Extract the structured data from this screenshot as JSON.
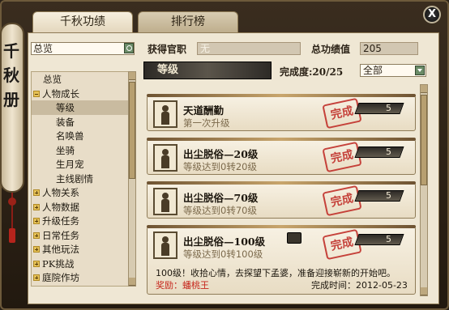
{
  "sidebar": {
    "title": "千秋册"
  },
  "tabs": [
    {
      "label": "千秋功绩",
      "active": true
    },
    {
      "label": "排行榜",
      "active": false
    }
  ],
  "close_label": "X",
  "search": {
    "value": "总览"
  },
  "tree": [
    {
      "label": "总览",
      "indent": 1,
      "toggle": "none"
    },
    {
      "label": "人物成长",
      "indent": 0,
      "toggle": "minus"
    },
    {
      "label": "等级",
      "indent": 2,
      "toggle": "none",
      "selected": true
    },
    {
      "label": "装备",
      "indent": 2,
      "toggle": "none"
    },
    {
      "label": "名唤兽",
      "indent": 2,
      "toggle": "none"
    },
    {
      "label": "坐骑",
      "indent": 2,
      "toggle": "none"
    },
    {
      "label": "生月宠",
      "indent": 2,
      "toggle": "none"
    },
    {
      "label": "主线剧情",
      "indent": 2,
      "toggle": "none"
    },
    {
      "label": "人物关系",
      "indent": 0,
      "toggle": "plus"
    },
    {
      "label": "人物数据",
      "indent": 0,
      "toggle": "plus"
    },
    {
      "label": "升级任务",
      "indent": 0,
      "toggle": "plus"
    },
    {
      "label": "日常任务",
      "indent": 0,
      "toggle": "plus"
    },
    {
      "label": "其他玩法",
      "indent": 0,
      "toggle": "plus"
    },
    {
      "label": "PK挑战",
      "indent": 0,
      "toggle": "plus"
    },
    {
      "label": "庭院作坊",
      "indent": 0,
      "toggle": "plus"
    }
  ],
  "header": {
    "title_label": "获得官职",
    "title_value": "无",
    "total_label": "总功绩值",
    "total_value": "205",
    "section": "等级",
    "progress_label": "完成度:20/25",
    "filter_value": "全部"
  },
  "achievements": [
    {
      "title": "天道酬勤",
      "desc": "第一次升级",
      "points": "5",
      "stamp": "完成"
    },
    {
      "title": "出尘脱俗—20级",
      "desc": "等级达到0转20级",
      "points": "5",
      "stamp": "完成"
    },
    {
      "title": "出尘脱俗—70级",
      "desc": "等级达到0转70级",
      "points": "5",
      "stamp": "完成"
    },
    {
      "title": "出尘脱俗—100级",
      "desc": "等级达到0转100级",
      "points": "5",
      "stamp": "完成",
      "note": "100级！收拾心情，去探望下孟婆，准备迎接崭新的开始吧。",
      "reward": "奖励：蟠桃王",
      "done_time": "完成时间：2012-05-23"
    }
  ]
}
